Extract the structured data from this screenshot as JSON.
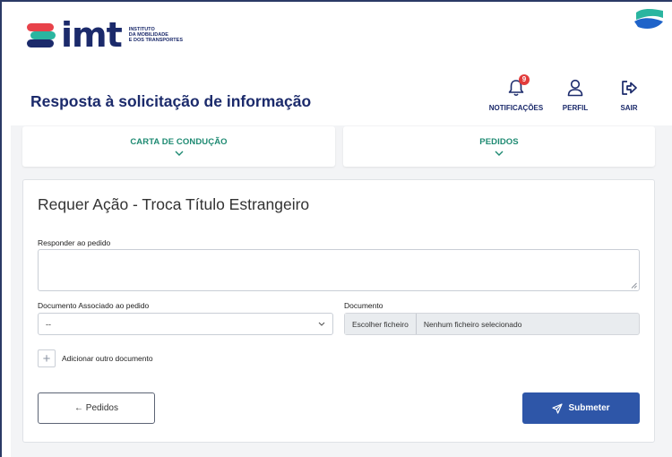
{
  "brand": {
    "logo_text": "imt",
    "subtitle": [
      "INSTITUTO",
      "DA MOBILIDADE",
      "E DOS TRANSPORTES"
    ],
    "colors": {
      "red": "#e8424a",
      "teal": "#2ab5a0",
      "navy": "#1b2a6b"
    }
  },
  "header": {
    "title": "Resposta à solicitação de informação",
    "actions": [
      {
        "label": "NOTIFICAÇÕES",
        "icon": "bell-icon",
        "badge": "9"
      },
      {
        "label": "PERFIL",
        "icon": "user-icon"
      },
      {
        "label": "SAIR",
        "icon": "logout-icon"
      }
    ]
  },
  "tabs": [
    {
      "label": "CARTA DE CONDUÇÃO",
      "icon": "chevron-down-icon"
    },
    {
      "label": "PEDIDOS",
      "icon": "chevron-down-icon"
    }
  ],
  "form": {
    "title": "Requer Ação - Troca Título Estrangeiro",
    "response_label": "Responder ao pedido",
    "response_value": "",
    "assoc_doc_label": "Documento Associado ao pedido",
    "assoc_doc_value": "--",
    "document_label": "Documento",
    "choose_file": "Escolher ficheiro",
    "no_file": "Nenhum ficheiro selecionado",
    "add_document": "Adicionar outro documento",
    "add_icon": "+"
  },
  "buttons": {
    "back": "← Pedidos",
    "submit": "Submeter",
    "submit_icon": "send-icon",
    "submit_color": "#2e56a8"
  }
}
